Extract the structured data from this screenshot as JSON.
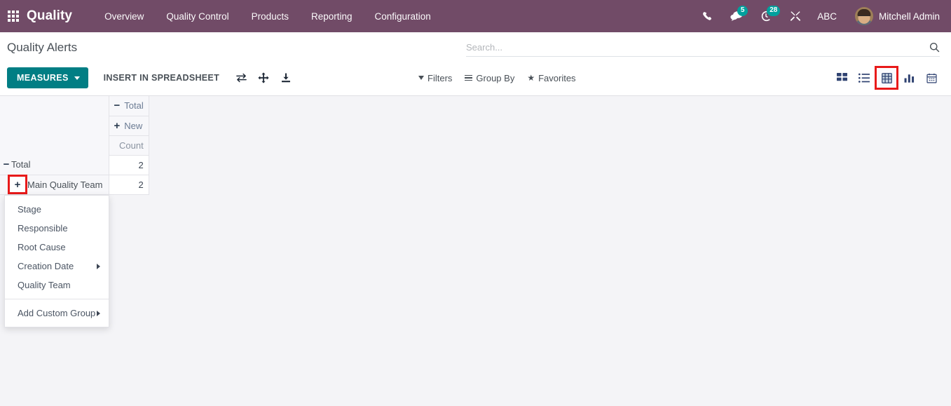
{
  "navbar": {
    "apps_icon": "apps-grid-icon",
    "brand": "Quality",
    "menu": [
      {
        "label": "Overview"
      },
      {
        "label": "Quality Control"
      },
      {
        "label": "Products"
      },
      {
        "label": "Reporting"
      },
      {
        "label": "Configuration"
      }
    ],
    "systray": {
      "phone_icon": "phone-icon",
      "messages_icon": "messages-icon",
      "messages_count": "5",
      "activities_icon": "activities-clock-icon",
      "activities_count": "28",
      "debug_icon": "tools-wrench-icon",
      "language": "ABC",
      "avatar_icon": "user-avatar",
      "user_name": "Mitchell Admin"
    },
    "accent_color": "#714b67",
    "badge_color": "#00a09d"
  },
  "control_panel": {
    "title": "Quality Alerts",
    "search": {
      "placeholder": "Search...",
      "value": "",
      "icon": "search-icon"
    },
    "buttons": {
      "measures": "MEASURES",
      "insert_in_spreadsheet": "INSERT IN SPREADSHEET"
    },
    "pivot_tools": [
      {
        "name": "flip-axis-icon",
        "title": "Flip axis"
      },
      {
        "name": "expand-all-icon",
        "title": "Expand all"
      },
      {
        "name": "download-xlsx-icon",
        "title": "Download xlsx"
      }
    ],
    "filters": [
      {
        "label": "Filters",
        "icon": "filter-funnel-icon"
      },
      {
        "label": "Group By",
        "icon": "group-by-icon"
      },
      {
        "label": "Favorites",
        "icon": "star-icon"
      }
    ],
    "views": [
      {
        "name": "kanban-view-icon",
        "active": false
      },
      {
        "name": "list-view-icon",
        "active": false
      },
      {
        "name": "pivot-view-icon",
        "active": true
      },
      {
        "name": "graph-view-icon",
        "active": false
      },
      {
        "name": "calendar-view-icon",
        "active": false
      }
    ],
    "highlight_color": "#e81a1a",
    "measures_color": "#017e84"
  },
  "pivot": {
    "col_headers": {
      "total": {
        "label": "Total",
        "toggle": "−"
      },
      "new": {
        "label": "New",
        "toggle": "+"
      },
      "measure": "Count"
    },
    "rows": [
      {
        "label": "Total",
        "toggle": "−",
        "indent": 0,
        "values": [
          "2"
        ],
        "highlighted": false
      },
      {
        "label": "Main Quality Team",
        "toggle": "+",
        "indent": 1,
        "values": [
          "2"
        ],
        "highlighted": true
      }
    ]
  },
  "groupby_menu": {
    "items": [
      {
        "label": "Stage",
        "submenu": false
      },
      {
        "label": "Responsible",
        "submenu": false
      },
      {
        "label": "Root Cause",
        "submenu": false
      },
      {
        "label": "Creation Date",
        "submenu": true
      },
      {
        "label": "Quality Team",
        "submenu": false
      }
    ],
    "footer": {
      "label": "Add Custom Group",
      "submenu": true
    }
  }
}
